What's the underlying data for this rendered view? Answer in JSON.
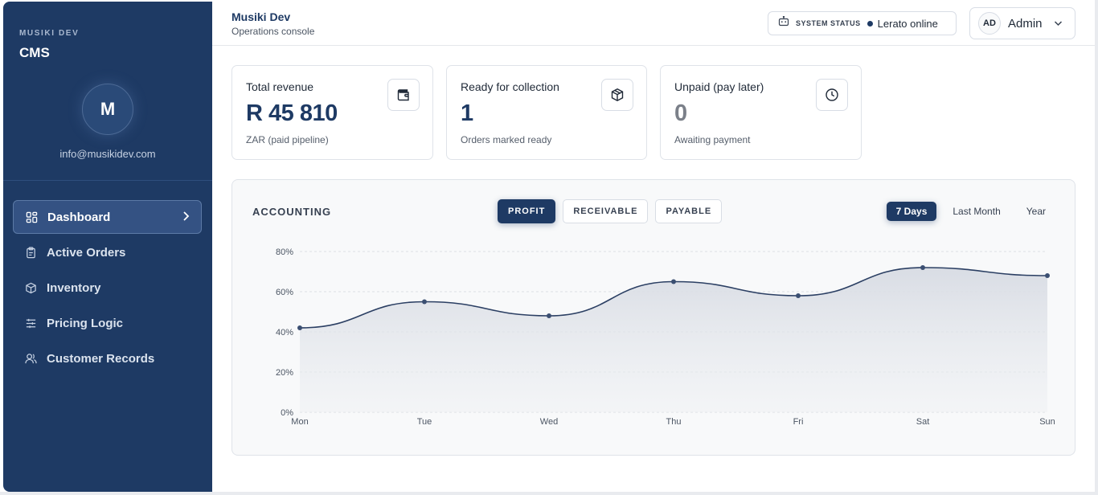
{
  "sidebar": {
    "brand_small": "MUSIKI DEV",
    "brand_big": "CMS",
    "avatar_letter": "M",
    "email": "info@musikidev.com",
    "items": [
      {
        "label": "Dashboard",
        "icon": "dashboard-grid-icon",
        "active": true
      },
      {
        "label": "Active Orders",
        "icon": "clipboard-icon"
      },
      {
        "label": "Inventory",
        "icon": "box-icon"
      },
      {
        "label": "Pricing Logic",
        "icon": "sliders-icon"
      },
      {
        "label": "Customer Records",
        "icon": "users-icon"
      }
    ]
  },
  "header": {
    "title": "Musiki Dev",
    "subtitle": "Operations console",
    "status_label": "SYSTEM STATUS",
    "status_text": "Lerato online",
    "admin_initials": "AD",
    "admin_name": "Admin"
  },
  "cards": [
    {
      "title": "Total revenue",
      "value": "R 45 810",
      "sub": "ZAR (paid pipeline)",
      "icon": "wallet-icon"
    },
    {
      "title": "Ready for collection",
      "value": "1",
      "sub": "Orders marked ready",
      "icon": "package-icon"
    },
    {
      "title": "Unpaid (pay later)",
      "value": "0",
      "sub": "Awaiting payment",
      "icon": "clock-icon"
    }
  ],
  "accounting": {
    "title": "ACCOUNTING",
    "tabs": [
      "PROFIT",
      "RECEIVABLE",
      "PAYABLE"
    ],
    "ranges": [
      "7 Days",
      "Last Month",
      "Year"
    ]
  },
  "colors": {
    "primary": "#1e3a64",
    "line": "#2b3f63"
  },
  "chart_data": {
    "type": "area",
    "categories": [
      "Mon",
      "Tue",
      "Wed",
      "Thu",
      "Fri",
      "Sat",
      "Sun"
    ],
    "values": [
      42,
      55,
      48,
      65,
      58,
      72,
      68
    ],
    "y_ticks": [
      "0%",
      "20%",
      "40%",
      "60%",
      "80%"
    ],
    "ylim": [
      0,
      80
    ],
    "grid": true
  }
}
